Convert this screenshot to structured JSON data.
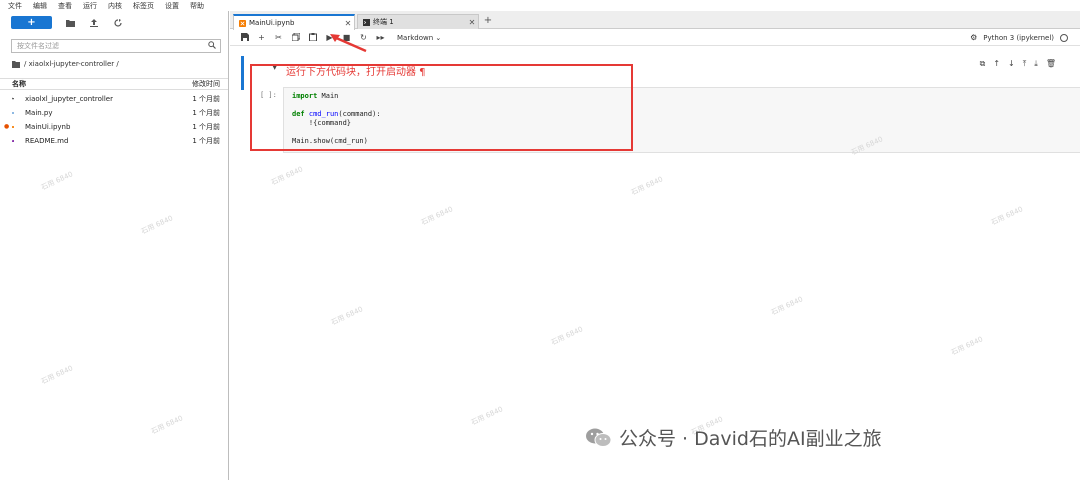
{
  "menu": [
    "文件",
    "编辑",
    "查看",
    "运行",
    "内核",
    "标签页",
    "设置",
    "帮助"
  ],
  "sidebar": {
    "new_label": "+",
    "filter_placeholder": "按文件名过滤",
    "breadcrumb": "/ xiaolxl-jupyter-controller /",
    "col_name": "名称",
    "col_modified": "修改时间",
    "files": [
      {
        "name": "xiaolxl_jupyter_controller",
        "modified": "1 个月前",
        "icon": "folder-icon"
      },
      {
        "name": "Main.py",
        "modified": "1 个月前",
        "icon": "python-file-icon"
      },
      {
        "name": "MainUi.ipynb",
        "modified": "1 个月前",
        "icon": "notebook-icon"
      },
      {
        "name": "README.md",
        "modified": "1 个月前",
        "icon": "markdown-icon"
      }
    ]
  },
  "tabs": [
    {
      "label": "MainUi.ipynb",
      "active": true
    },
    {
      "label": "终端 1",
      "active": false
    }
  ],
  "notebook": {
    "cell_type": "Markdown",
    "kernel": "Python 3 (ipykernel)",
    "markdown_heading": "运行下方代码块，打开启动器 ¶",
    "prompt": "[ ]:",
    "code_lines": [
      "import Main",
      "",
      "def cmd_run(command):",
      "    !{command}",
      "",
      "Main.show(cmd_run)"
    ]
  },
  "watermark_text": "石用 6840",
  "footer": "公众号 · David石的AI副业之旅",
  "colors": {
    "accent": "#1976d2",
    "annotation": "#e53935"
  }
}
